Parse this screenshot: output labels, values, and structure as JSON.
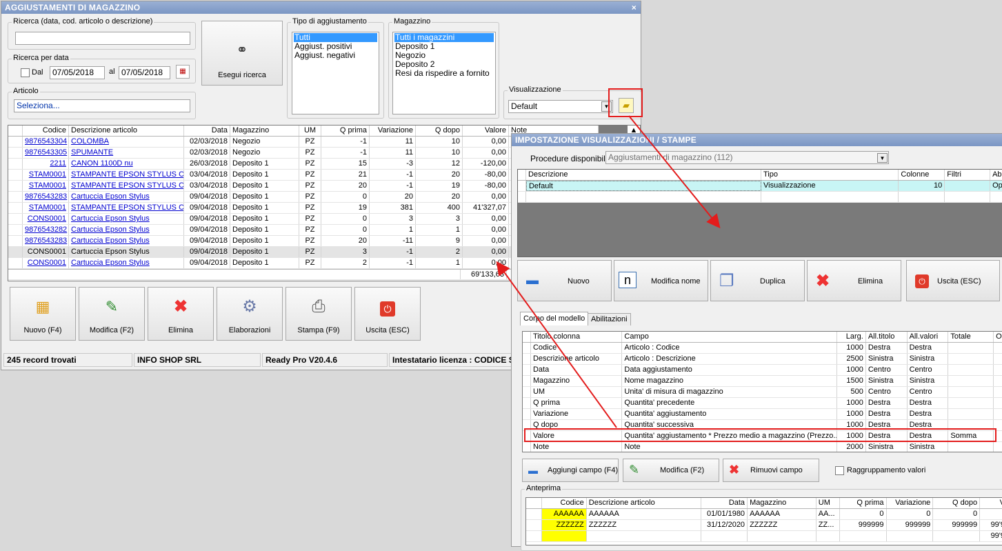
{
  "main": {
    "title": "AGGIUSTAMENTI DI MAGAZZINO",
    "close": "×",
    "search": {
      "label": "Ricerca (data, cod. articolo o descrizione)",
      "value": ""
    },
    "date": {
      "label": "Ricerca per data",
      "dal_label": "Dal",
      "from": "07/05/2018",
      "al_label": "al",
      "to": "07/05/2018"
    },
    "articolo": {
      "label": "Articolo",
      "value": "Seleziona..."
    },
    "search_button": "Esegui ricerca",
    "tipo": {
      "label": "Tipo di aggiustamento",
      "items": [
        "Tutti",
        "Aggiust. positivi",
        "Aggiust. negativi"
      ]
    },
    "magazzino": {
      "label": "Magazzino",
      "items": [
        "Tutti i magazzini",
        "Deposito 1",
        "Negozio",
        "Deposito 2",
        "Resi da rispedire a fornito"
      ]
    },
    "visual": {
      "label": "Visualizzazione",
      "value": "Default"
    },
    "grid": {
      "headers": [
        "Codice",
        "Descrizione articolo",
        "Data",
        "Magazzino",
        "UM",
        "Q prima",
        "Variazione",
        "Q dopo",
        "Valore",
        "Note"
      ],
      "rows": [
        [
          "9876543304",
          "COLOMBA",
          "02/03/2018",
          "Negozio",
          "PZ",
          "-1",
          "11",
          "10",
          "0,00"
        ],
        [
          "9876543305",
          "SPUMANTE",
          "02/03/2018",
          "Negozio",
          "PZ",
          "-1",
          "11",
          "10",
          "0,00"
        ],
        [
          "2211",
          "CANON 1100D nu",
          "26/03/2018",
          "Deposito 1",
          "PZ",
          "15",
          "-3",
          "12",
          "-120,00"
        ],
        [
          "STAM0001",
          "STAMPANTE EPSON STYLUS C...",
          "03/04/2018",
          "Deposito 1",
          "PZ",
          "21",
          "-1",
          "20",
          "-80,00"
        ],
        [
          "STAM0001",
          "STAMPANTE EPSON STYLUS C...",
          "03/04/2018",
          "Deposito 1",
          "PZ",
          "20",
          "-1",
          "19",
          "-80,00"
        ],
        [
          "9876543283",
          "Cartuccia Epson Stylus",
          "09/04/2018",
          "Deposito 1",
          "PZ",
          "0",
          "20",
          "20",
          "0,00"
        ],
        [
          "STAM0001",
          "STAMPANTE EPSON STYLUS C...",
          "09/04/2018",
          "Deposito 1",
          "PZ",
          "19",
          "381",
          "400",
          "41'327,07"
        ],
        [
          "CONS0001",
          "Cartuccia Epson Stylus",
          "09/04/2018",
          "Deposito 1",
          "PZ",
          "0",
          "3",
          "3",
          "0,00"
        ],
        [
          "9876543282",
          "Cartuccia Epson Stylus",
          "09/04/2018",
          "Deposito 1",
          "PZ",
          "0",
          "1",
          "1",
          "0,00"
        ],
        [
          "9876543283",
          "Cartuccia Epson Stylus",
          "09/04/2018",
          "Deposito 1",
          "PZ",
          "20",
          "-11",
          "9",
          "0,00"
        ],
        [
          "CONS0001",
          "Cartuccia Epson Stylus",
          "09/04/2018",
          "Deposito 1",
          "PZ",
          "3",
          "-1",
          "2",
          "0,00"
        ],
        [
          "CONS0001",
          "Cartuccia Epson Stylus",
          "09/04/2018",
          "Deposito 1",
          "PZ",
          "2",
          "-1",
          "1",
          "0,00"
        ]
      ],
      "total": "69'133,63"
    },
    "buttons": {
      "nuovo": "Nuovo (F4)",
      "modifica": "Modifica (F2)",
      "elimina": "Elimina",
      "elaborazioni": "Elaborazioni",
      "stampa": "Stampa (F9)",
      "uscita": "Uscita (ESC)"
    },
    "status": [
      "245 record trovati",
      "INFO SHOP SRL",
      "Ready Pro V20.4.6",
      "Intestatario licenza : CODICE SI"
    ]
  },
  "dialog": {
    "title": "IMPOSTAZIONE VISUALIZZAZIONI / STAMPE",
    "proc_label": "Procedure disponibili :",
    "proc_value": "Aggiustamenti di magazzino (112)",
    "grid": {
      "headers": [
        "Descrizione",
        "Tipo",
        "Colonne",
        "Filtri",
        "Ab"
      ],
      "row": [
        "Default",
        "Visualizzazione",
        "10",
        "",
        "Op"
      ]
    },
    "buttons": {
      "nuovo": "Nuovo",
      "modifica": "Modifica nome",
      "duplica": "Duplica",
      "elimina": "Elimina",
      "uscita": "Uscita (ESC)"
    },
    "tabs": [
      "Corpo del modello",
      "Abilitazioni"
    ],
    "fields": {
      "headers": [
        "Titolo colonna",
        "Campo",
        "Larg.",
        "All.titolo",
        "All.valori",
        "Totale",
        "O"
      ],
      "rows": [
        [
          "Codice",
          "Articolo : Codice",
          "1000",
          "Destra",
          "Destra",
          ""
        ],
        [
          "Descrizione articolo",
          "Articolo : Descrizione",
          "2500",
          "Sinistra",
          "Sinistra",
          ""
        ],
        [
          "Data",
          "Data aggiustamento",
          "1000",
          "Centro",
          "Centro",
          ""
        ],
        [
          "Magazzino",
          "Nome magazzino",
          "1500",
          "Sinistra",
          "Sinistra",
          ""
        ],
        [
          "UM",
          "Unita' di misura di magazzino",
          "500",
          "Centro",
          "Centro",
          ""
        ],
        [
          "Q prima",
          "Quantita' precedente",
          "1000",
          "Destra",
          "Destra",
          ""
        ],
        [
          "Variazione",
          "Quantita' aggiustamento",
          "1000",
          "Destra",
          "Destra",
          ""
        ],
        [
          "Q dopo",
          "Quantita' successiva",
          "1000",
          "Destra",
          "Destra",
          ""
        ],
        [
          "Valore",
          "Quantita' aggiustamento * Prezzo medio a magazzino (Prezzo...",
          "1000",
          "Destra",
          "Destra",
          "Somma"
        ],
        [
          "Note",
          "Note",
          "2000",
          "Sinistra",
          "Sinistra",
          ""
        ]
      ]
    },
    "field_buttons": {
      "aggiungi": "Aggiungi campo (F4)",
      "modifica": "Modifica (F2)",
      "rimuovi": "Rimuovi campo",
      "raggruppamento": "Raggruppamento valori"
    },
    "preview": {
      "label": "Anteprima",
      "headers": [
        "Codice",
        "Descrizione articolo",
        "Data",
        "Magazzino",
        "UM",
        "Q prima",
        "Variazione",
        "Q dopo",
        "V"
      ],
      "rows": [
        [
          "AAAAAA",
          "AAAAAA",
          "01/01/1980",
          "AAAAAA",
          "AA...",
          "0",
          "0",
          "0",
          ""
        ],
        [
          "ZZZZZZ",
          "ZZZZZZ",
          "31/12/2020",
          "ZZZZZZ",
          "ZZ...",
          "999999",
          "999999",
          "999999",
          "99'9"
        ],
        [
          "",
          "",
          "",
          "",
          "",
          "",
          "",
          "",
          "99'9"
        ]
      ]
    }
  },
  "colors": {
    "annotation": "#e31c1c",
    "title_bar": "#7b96c4",
    "selection": "#3399ff",
    "preview_key": "#ffff00",
    "selected_row": "#c8f5f5"
  }
}
